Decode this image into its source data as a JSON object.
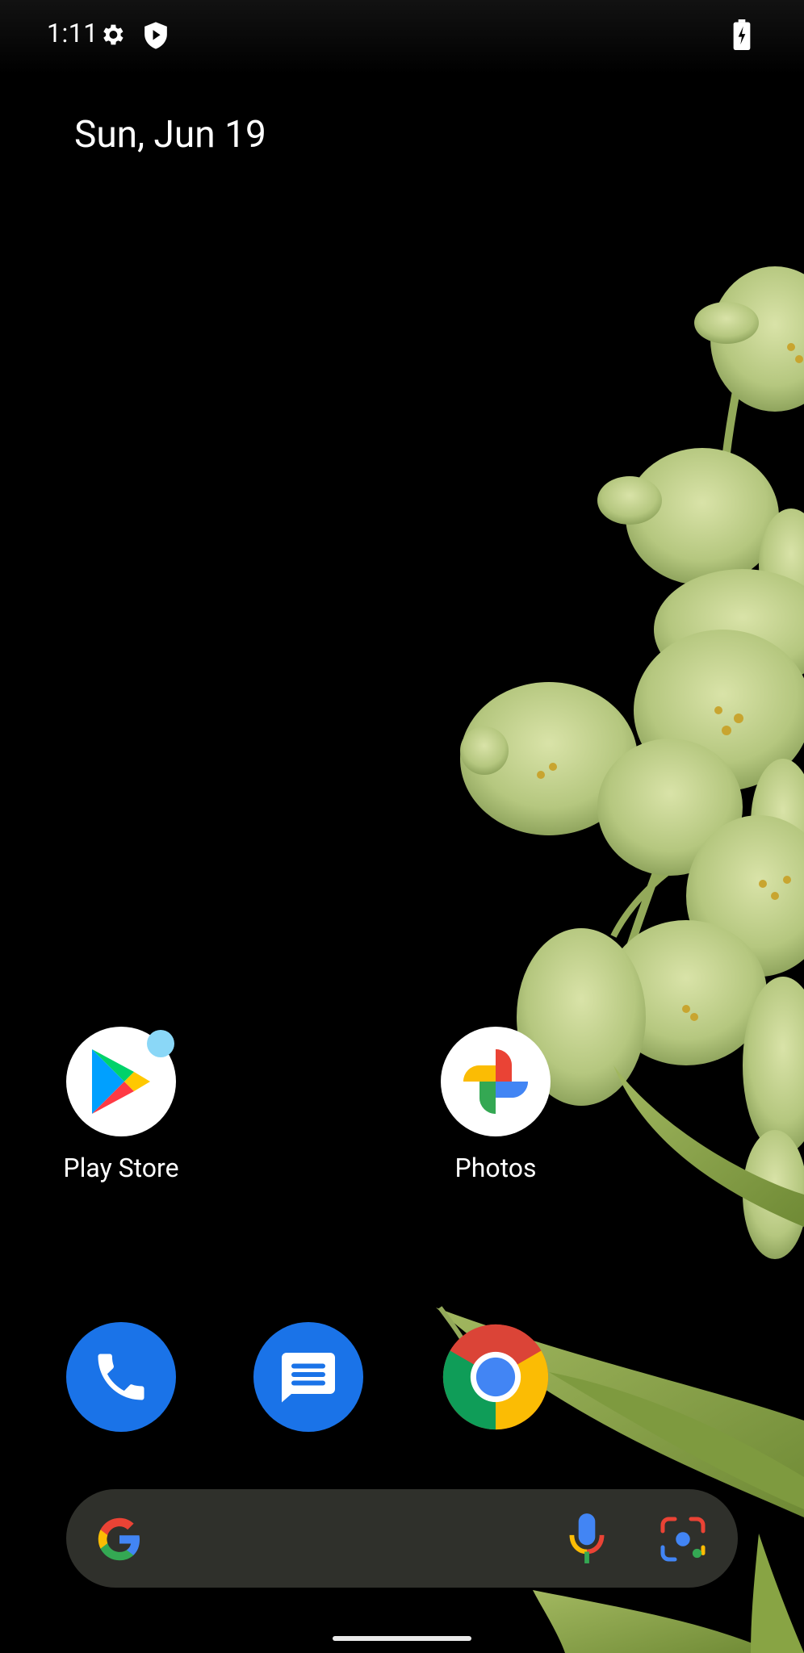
{
  "status_bar": {
    "time": "1:11",
    "icons": [
      "gear-icon",
      "shield-play-icon",
      "battery-charging-icon"
    ]
  },
  "date_widget": {
    "date": "Sun, Jun 19"
  },
  "home_apps": [
    {
      "label": "Play Store",
      "icon": "play-store-icon",
      "has_notification_dot": true
    },
    {
      "label": "Photos",
      "icon": "photos-icon",
      "has_notification_dot": false
    }
  ],
  "dock": [
    {
      "name": "Phone",
      "icon": "phone-icon"
    },
    {
      "name": "Messages",
      "icon": "messages-icon"
    },
    {
      "name": "Chrome",
      "icon": "chrome-icon"
    }
  ],
  "search_bar": {
    "icons": [
      "google-g-icon",
      "microphone-icon",
      "lens-icon"
    ]
  },
  "colors": {
    "accent_blue": "#1a73e8",
    "notification_dot": "#8ad7f7",
    "search_bg": "#2f302b",
    "flower_green": "#b9cc86"
  }
}
